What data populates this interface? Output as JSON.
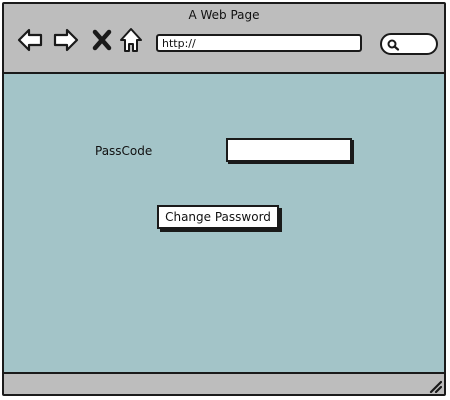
{
  "window": {
    "title": "A Web Page"
  },
  "toolbar": {
    "back_icon": "arrow-left-icon",
    "forward_icon": "arrow-right-icon",
    "stop_icon": "close-icon",
    "home_icon": "home-icon",
    "url_value": "http://",
    "search_icon": "search-icon"
  },
  "form": {
    "passcode_label": "PassCode",
    "passcode_value": "",
    "submit_label": "Change Password"
  },
  "colors": {
    "chrome": "#bdbdbd",
    "content_bg": "#a3c4c8",
    "border": "#1a1a1a"
  }
}
